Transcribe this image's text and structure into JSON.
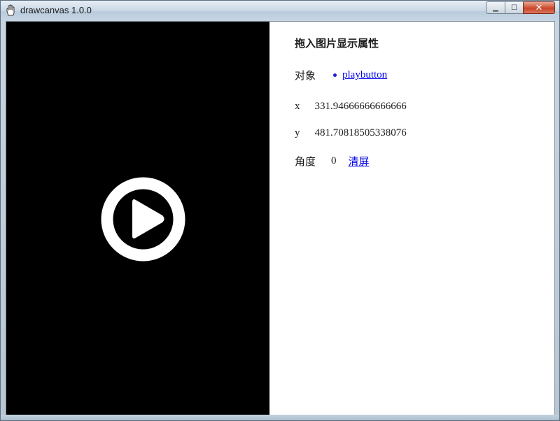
{
  "window": {
    "title": "drawcanvas 1.0.0",
    "controls": {
      "minimize_glyph": "▁",
      "maximize_glyph": "☐",
      "close_glyph": "✕"
    },
    "title_icon": "hand-icon"
  },
  "canvas": {
    "background": "#000000",
    "object_icon": "play-circle-icon"
  },
  "panel": {
    "heading": "拖入图片显示属性",
    "object_label": "对象",
    "objects": [
      "playbutton"
    ],
    "x_label": "x",
    "x_value": "331.94666666666666",
    "y_label": "y",
    "y_value": "481.70818505338076",
    "angle_label": "角度",
    "angle_value": "0",
    "clear_label": "清屏"
  },
  "colors": {
    "link": "#0000ee",
    "close_button": "#c8442a"
  }
}
